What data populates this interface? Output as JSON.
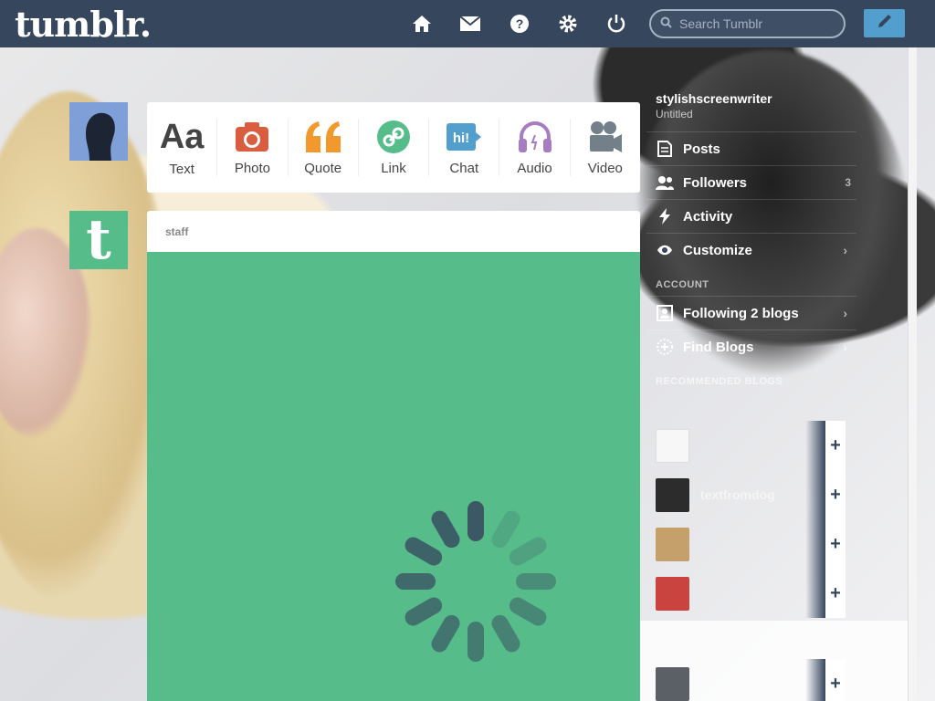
{
  "header": {
    "logo": "tumblr.",
    "search_placeholder": "Search Tumblr",
    "icons": [
      "home-icon",
      "mail-icon",
      "help-icon",
      "gear-icon",
      "power-icon"
    ],
    "compose_icon": "pencil-icon"
  },
  "post_types": [
    {
      "label": "Text",
      "icon": "text-icon",
      "color": "#444444"
    },
    {
      "label": "Photo",
      "icon": "camera-icon",
      "color": "#d95e40"
    },
    {
      "label": "Quote",
      "icon": "quote-icon",
      "color": "#f2992e"
    },
    {
      "label": "Link",
      "icon": "link-icon",
      "color": "#56bc8a"
    },
    {
      "label": "Chat",
      "icon": "chat-icon",
      "color": "#529ecc"
    },
    {
      "label": "Audio",
      "icon": "headphones-icon",
      "color": "#a77dc2"
    },
    {
      "label": "Video",
      "icon": "video-icon",
      "color": "#748089"
    }
  ],
  "post": {
    "blog_name": "staff",
    "colors": {
      "background": "#56bc8a",
      "spinner": "#36465d"
    }
  },
  "sidebar": {
    "blog_title": "stylishscreenwriter",
    "blog_subtitle": "Untitled",
    "items": [
      {
        "label": "Posts",
        "icon": "document-icon",
        "count": ""
      },
      {
        "label": "Followers",
        "icon": "people-icon",
        "count": "3"
      },
      {
        "label": "Activity",
        "icon": "bolt-icon",
        "count": ""
      },
      {
        "label": "Customize",
        "icon": "eye-icon",
        "count": ""
      }
    ],
    "account_header": "ACCOUNT",
    "account_items": [
      {
        "label": "Following 2 blogs",
        "icon": "person-card-icon"
      },
      {
        "label": "Find Blogs",
        "icon": "compass-icon"
      }
    ],
    "recommended_header": "RECOMMENDED BLOGS",
    "recommended": [
      {
        "name": "",
        "thumb_color": "#f7f7f7"
      },
      {
        "name": "textfromdog",
        "thumb_color": "#2c2c2c"
      },
      {
        "name": "",
        "thumb_color": "#c6a06b"
      },
      {
        "name": "",
        "thumb_color": "#c9443f"
      },
      {
        "name": "",
        "thumb_color": "#5b5f66"
      }
    ],
    "add_label": "+"
  }
}
